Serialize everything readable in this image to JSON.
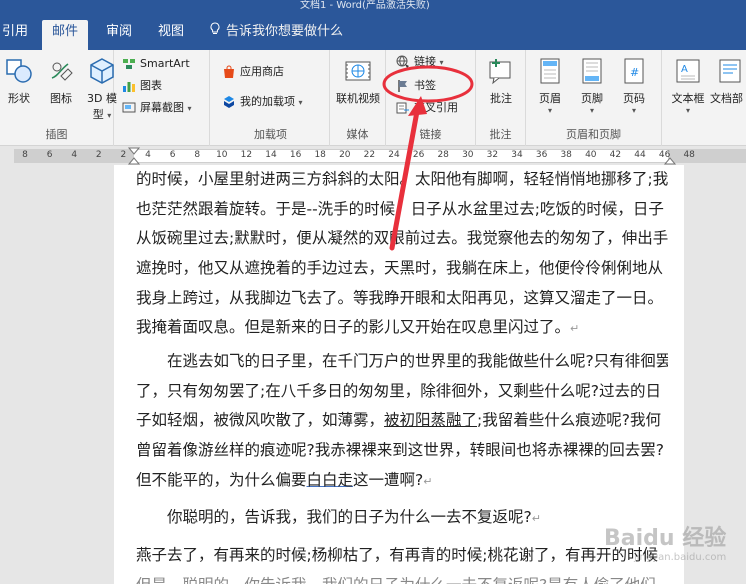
{
  "window": {
    "title": "文档1 - Word(产品激活失败)"
  },
  "tabs": {
    "items": [
      "引用",
      "邮件",
      "审阅",
      "视图"
    ],
    "active_index": 1,
    "tell_me": "告诉我你想要做什么"
  },
  "ribbon": {
    "groups": {
      "illustrations": {
        "label": "插图",
        "shapes": "形状",
        "icons": "图标",
        "model3d_line1": "3D 模",
        "model3d_line2": "型",
        "smartart": "SmartArt",
        "chart": "图表",
        "screenshot": "屏幕截图"
      },
      "addins": {
        "label": "加载项",
        "store": "应用商店",
        "my_addins": "我的加载项"
      },
      "media": {
        "label": "媒体",
        "online_video": "联机视频"
      },
      "links": {
        "label": "链接",
        "link": "链接",
        "bookmark": "书签",
        "cross_ref": "交叉引用"
      },
      "comments": {
        "label": "批注",
        "comment": "批注"
      },
      "header_footer": {
        "label": "页眉和页脚",
        "header": "页眉",
        "footer": "页脚",
        "page_number": "页码"
      },
      "text": {
        "textbox": "文本框",
        "parts": "文档部"
      }
    }
  },
  "ruler": {
    "numbers": [
      "8",
      "6",
      "4",
      "2",
      "2",
      "4",
      "6",
      "8",
      "10",
      "12",
      "14",
      "16",
      "18",
      "20",
      "22",
      "24",
      "26",
      "28",
      "30",
      "32",
      "34",
      "36",
      "38",
      "40",
      "42",
      "44",
      "46",
      "48"
    ]
  },
  "document": {
    "para1": [
      "的时候，小屋里射进两三方斜斜的太阳。太阳他有脚啊，轻轻悄悄地挪移了;我",
      "也茫茫然跟着旋转。于是--洗手的时候，日子从水盆里过去;吃饭的时候，日子",
      "从饭碗里过去;默默时，便从凝然的双眼前过去。我觉察他去的匆匆了，伸出手",
      "遮挽时，他又从遮挽着的手边过去，天黑时，我躺在床上，他便伶伶俐俐地从",
      "我身上跨过，从我脚边飞去了。等我睁开眼和太阳再见，这算又溜走了一日。",
      "我掩着面叹息。但是新来的日子的影儿又开始在叹息里闪过了。"
    ],
    "para2": {
      "l1": "在逃去如飞的日子里，在千门万户的世界里的我能做些什么呢?只有徘徊罢",
      "l2": "了，只有匆匆罢了;在八千多日的匆匆里，除徘徊外，又剩些什么呢?过去的日",
      "l3_a": "子如轻烟，被微风吹散了，如薄雾，",
      "l3_u": "被初阳蒸融了",
      "l3_b": ";我留着些什么痕迹呢?我何",
      "l4": "曾留着像游丝样的痕迹呢?我赤裸裸来到这世界，转眼间也将赤裸裸的回去罢?",
      "l5_a": "但不能平的，为什么偏要",
      "l5_u": "白白走",
      "l5_b": "这一遭啊?"
    },
    "para3": "你聪明的，告诉我，我们的日子为什么一去不复返呢?",
    "para4": [
      "燕子去了，有再来的时候;杨柳枯了，有再青的时候;桃花谢了，有再开的时候",
      "但是，聪明的，你告诉我，我们的日子为什么一去不复返呢?是有人偷了他们"
    ],
    "para_mark": "↵"
  },
  "annotation": {
    "circle_color": "#e8303c"
  },
  "watermark": {
    "text": "Baidu 经验",
    "sub": "jingyan.baidu.com"
  },
  "colors": {
    "accent": "#2b579a"
  }
}
